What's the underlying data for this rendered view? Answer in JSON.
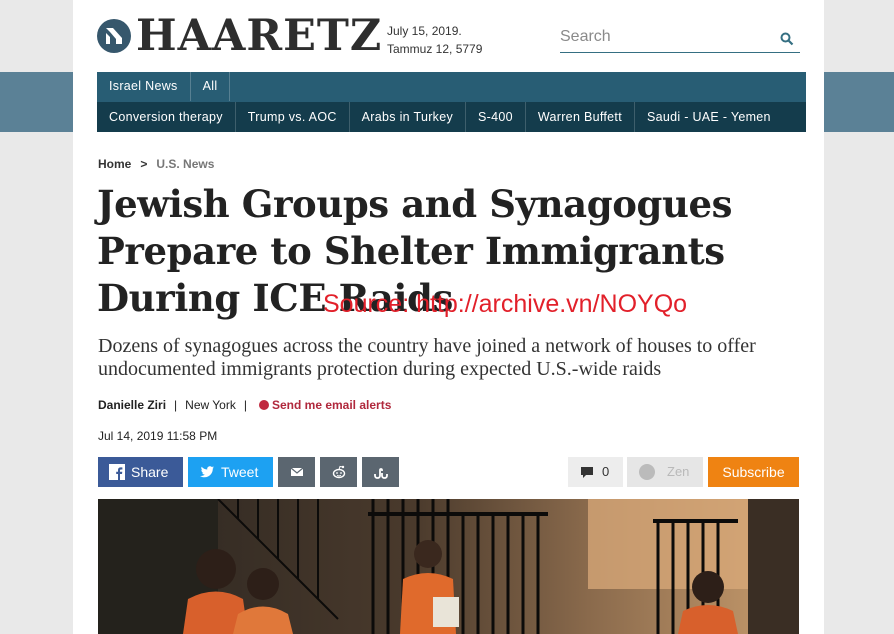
{
  "header": {
    "logo_text": "HAARETZ",
    "date_gregorian": "July 15, 2019.",
    "date_hebrew": "Tammuz 12, 5779",
    "search_placeholder": "Search"
  },
  "nav": {
    "row1": [
      "Israel News",
      "All"
    ],
    "row2": [
      "Conversion therapy",
      "Trump vs. AOC",
      "Arabs in Turkey",
      "S-400",
      "Warren Buffett",
      "Saudi - UAE - Yemen"
    ]
  },
  "breadcrumb": {
    "home": "Home",
    "separator": ">",
    "section": "U.S. News"
  },
  "article": {
    "headline": "Jewish Groups and Synagogues Prepare to Shelter Immigrants During ICE Raids",
    "source_note": "Source: http://archive.vn/NOYQo",
    "subtitle": "Dozens of synagogues across the country have joined a network of houses to offer undocumented immigrants protection during expected U.S.-wide raids",
    "author": "Danielle Ziri",
    "location": "New York",
    "email_alerts": "Send me email alerts",
    "published": "Jul 14, 2019 11:58 PM"
  },
  "share": {
    "facebook": "Share",
    "twitter": "Tweet",
    "comments_count": "0",
    "zen": "Zen",
    "subscribe": "Subscribe"
  },
  "colors": {
    "nav_dark": "#143c4c",
    "nav_mid": "#285d74",
    "facebook": "#3b5a98",
    "twitter": "#1da1f2",
    "subscribe": "#ef8312",
    "source_note": "#e2202a"
  },
  "icons": [
    "logo-icon",
    "search-icon",
    "facebook-icon",
    "twitter-icon",
    "mail-icon",
    "reddit-icon",
    "stumbleupon-icon",
    "comment-icon",
    "zen-icon",
    "alert-icon"
  ]
}
